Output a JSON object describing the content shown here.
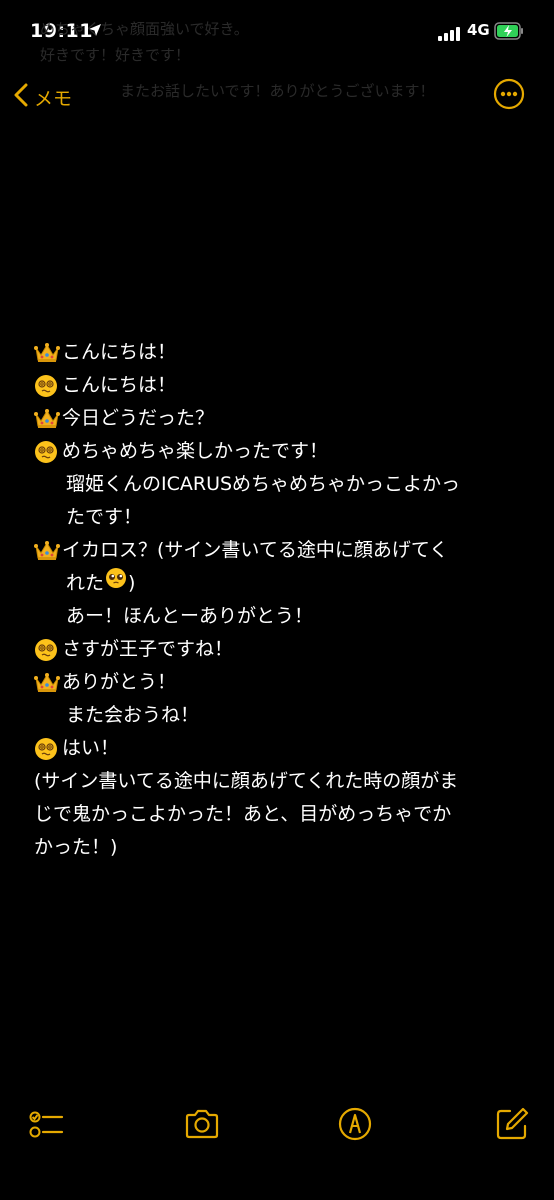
{
  "status_bar": {
    "time": "19:11",
    "network": "4G",
    "location_icon": "location-arrow-icon",
    "signal_icon": "signal-bars-icon",
    "battery_icon": "battery-charging-icon"
  },
  "background_text": {
    "line1": "めちゃくちゃ顔面強いで好き。",
    "line2": "好きです！好きです！",
    "line3": "またお話したいです！ありがとうございます！"
  },
  "nav": {
    "back_label": "メモ",
    "back_icon": "chevron-left-icon",
    "more_icon": "more-circle-icon"
  },
  "note": {
    "line1": "こんにちは！",
    "line2": "こんにちは！",
    "line3": "今日どうだった？",
    "line4": "めちゃめちゃ楽しかったです！",
    "line5": "瑠姫くんのICARUSめちゃめちゃかっこよかっ",
    "line6": "たです！",
    "line7": "イカロス？(サイン書いてる途中に顔あげてく",
    "line8a": "れた",
    "line8b": ")",
    "line9": "あー！ほんとーありがとう！",
    "line10": "さすが王子ですね！",
    "line11": "ありがとう！",
    "line12": "また会おうね！",
    "line13": "はい！",
    "line14": "(サイン書いてる途中に顔あげてくれた時の顔がま",
    "line15": "じで鬼かっこよかった！あと、目がめっちゃでか",
    "line16": "かった！)"
  },
  "toolbar": {
    "checklist_icon": "checklist-icon",
    "camera_icon": "camera-icon",
    "markup_icon": "markup-pen-icon",
    "compose_icon": "compose-icon"
  },
  "colors": {
    "accent": "#e5a900",
    "background": "#000000",
    "text": "#ffffff"
  }
}
